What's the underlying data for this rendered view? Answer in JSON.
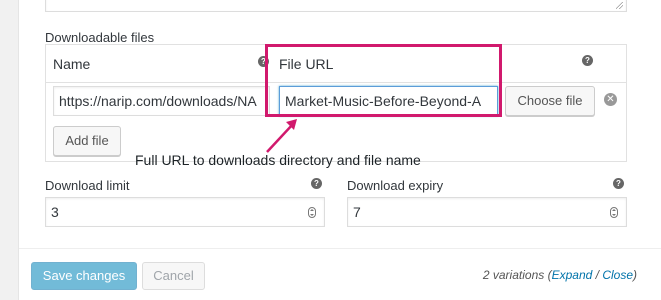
{
  "downloads": {
    "section_label": "Downloadable files",
    "columns": {
      "name": "Name",
      "file_url": "File URL"
    },
    "help_glyph": "?",
    "row": {
      "name_value": "https://narip.com/downloads/NA",
      "url_value": "Market-Music-Before-Beyond-A",
      "choose_file_label": "Choose file",
      "remove_glyph": "✕"
    },
    "add_file_label": "Add file"
  },
  "annotation": {
    "text": "Full URL to downloads directory and file name",
    "color": "#d1196d"
  },
  "limits": {
    "download_limit": {
      "label": "Download limit",
      "value": "3"
    },
    "download_expiry": {
      "label": "Download expiry",
      "value": "7"
    }
  },
  "footer": {
    "save_label": "Save changes",
    "cancel_label": "Cancel",
    "variations_count": "2 variations",
    "open_paren": "(",
    "expand_label": "Expand",
    "separator": " / ",
    "close_label": "Close",
    "close_paren": ")"
  },
  "colors": {
    "primary": "#0085ba",
    "link": "#0073aa",
    "highlight": "#d1196d"
  }
}
